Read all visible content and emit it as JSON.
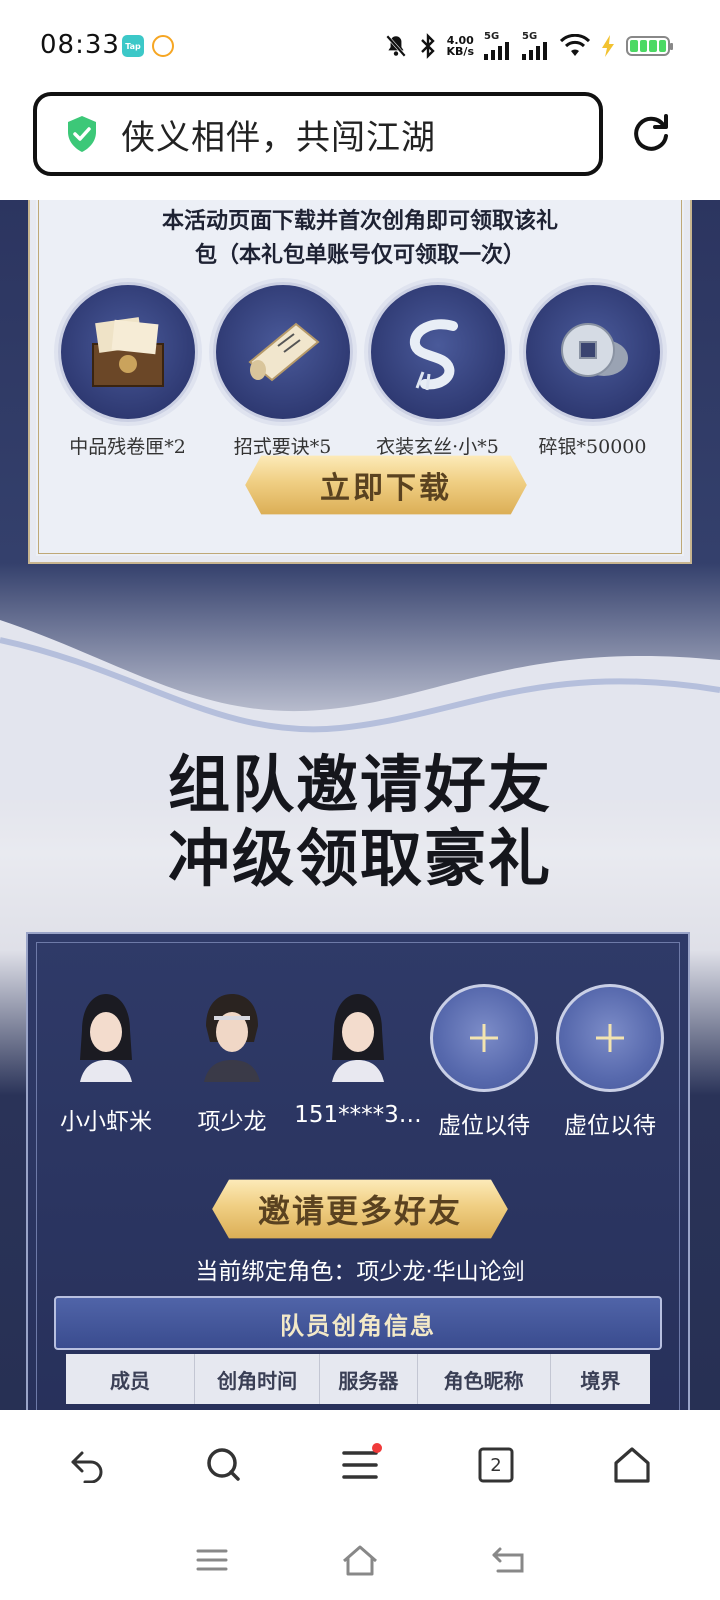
{
  "status_bar": {
    "time": "08:33",
    "app_icon_1": "Tap",
    "network_speed_value": "4.00",
    "network_speed_unit": "KB/s",
    "signal_1": "5G",
    "signal_2": "5G",
    "icons": [
      "mute-icon",
      "bluetooth-icon",
      "signal-icon",
      "wifi-icon",
      "battery-icon"
    ]
  },
  "browser": {
    "title": "侠义相伴，共闯江湖",
    "tab_count": "2",
    "accent_color": "#3cc878"
  },
  "gift": {
    "notice_line1": "本活动页面下载并首次创角即可领取该礼",
    "notice_line2": "包（本礼包单账号仅可领取一次）",
    "items": [
      {
        "label": "中品残卷匣*2",
        "icon": "treasure-box-icon"
      },
      {
        "label": "招式要诀*5",
        "icon": "scroll-icon"
      },
      {
        "label": "衣装玄丝·小*5",
        "icon": "silk-icon"
      },
      {
        "label": "碎银*50000",
        "icon": "coin-icon"
      }
    ],
    "download_label": "立即下载"
  },
  "team": {
    "headline_line1": "组队邀请好友",
    "headline_line2": "冲级领取豪礼",
    "members": [
      {
        "name": "小小虾米",
        "type": "female"
      },
      {
        "name": "项少龙",
        "type": "male"
      },
      {
        "name": "151****3…",
        "type": "female"
      },
      {
        "name": "虚位以待",
        "type": "empty"
      },
      {
        "name": "虚位以待",
        "type": "empty"
      }
    ],
    "invite_label": "邀请更多好友",
    "bound_role": "当前绑定角色：项少龙·华山论剑",
    "info_title": "队员创角信息",
    "table_headers": [
      "成员",
      "创角时间",
      "服务器",
      "角色昵称",
      "境界"
    ]
  }
}
